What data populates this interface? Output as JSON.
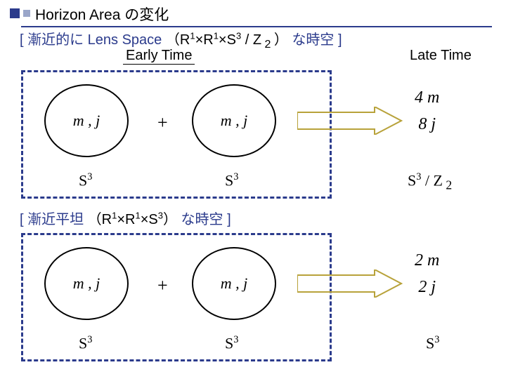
{
  "title": "Horizon Area の変化",
  "section1": {
    "heading_pre": "[  漸近的に Lens Space",
    "heading_paren_open": "（",
    "heading_formula": "R¹×R¹×S³ / Z",
    "heading_sub": "2",
    "heading_paren_close": "）",
    "heading_post": " な時空 ]",
    "early_label": "Early Time",
    "late_label": "Late Time",
    "circle1": "m  ,  j",
    "plus": "+",
    "circle2": "m  ,  j",
    "s3_left": "S",
    "s3_left_sup": "3",
    "s3_right": "S",
    "s3_right_sup": "3",
    "late_top": "4 m",
    "late_bot": "8 j",
    "late_s3": "S³ / Z",
    "late_s3_sub": "2"
  },
  "section2": {
    "heading_pre": "[  漸近平坦 ",
    "heading_paren_open": "（",
    "heading_formula": "R¹×R¹×S³",
    "heading_paren_close": "）",
    "heading_post": " な時空 ]",
    "circle1": "m  ,  j",
    "plus": "+",
    "circle2": "m  ,  j",
    "s3_left": "S",
    "s3_left_sup": "3",
    "s3_right": "S",
    "s3_right_sup": "3",
    "late_top": "2 m",
    "late_bot": "2 j",
    "late_s3": "S",
    "late_s3_sup": "3"
  }
}
